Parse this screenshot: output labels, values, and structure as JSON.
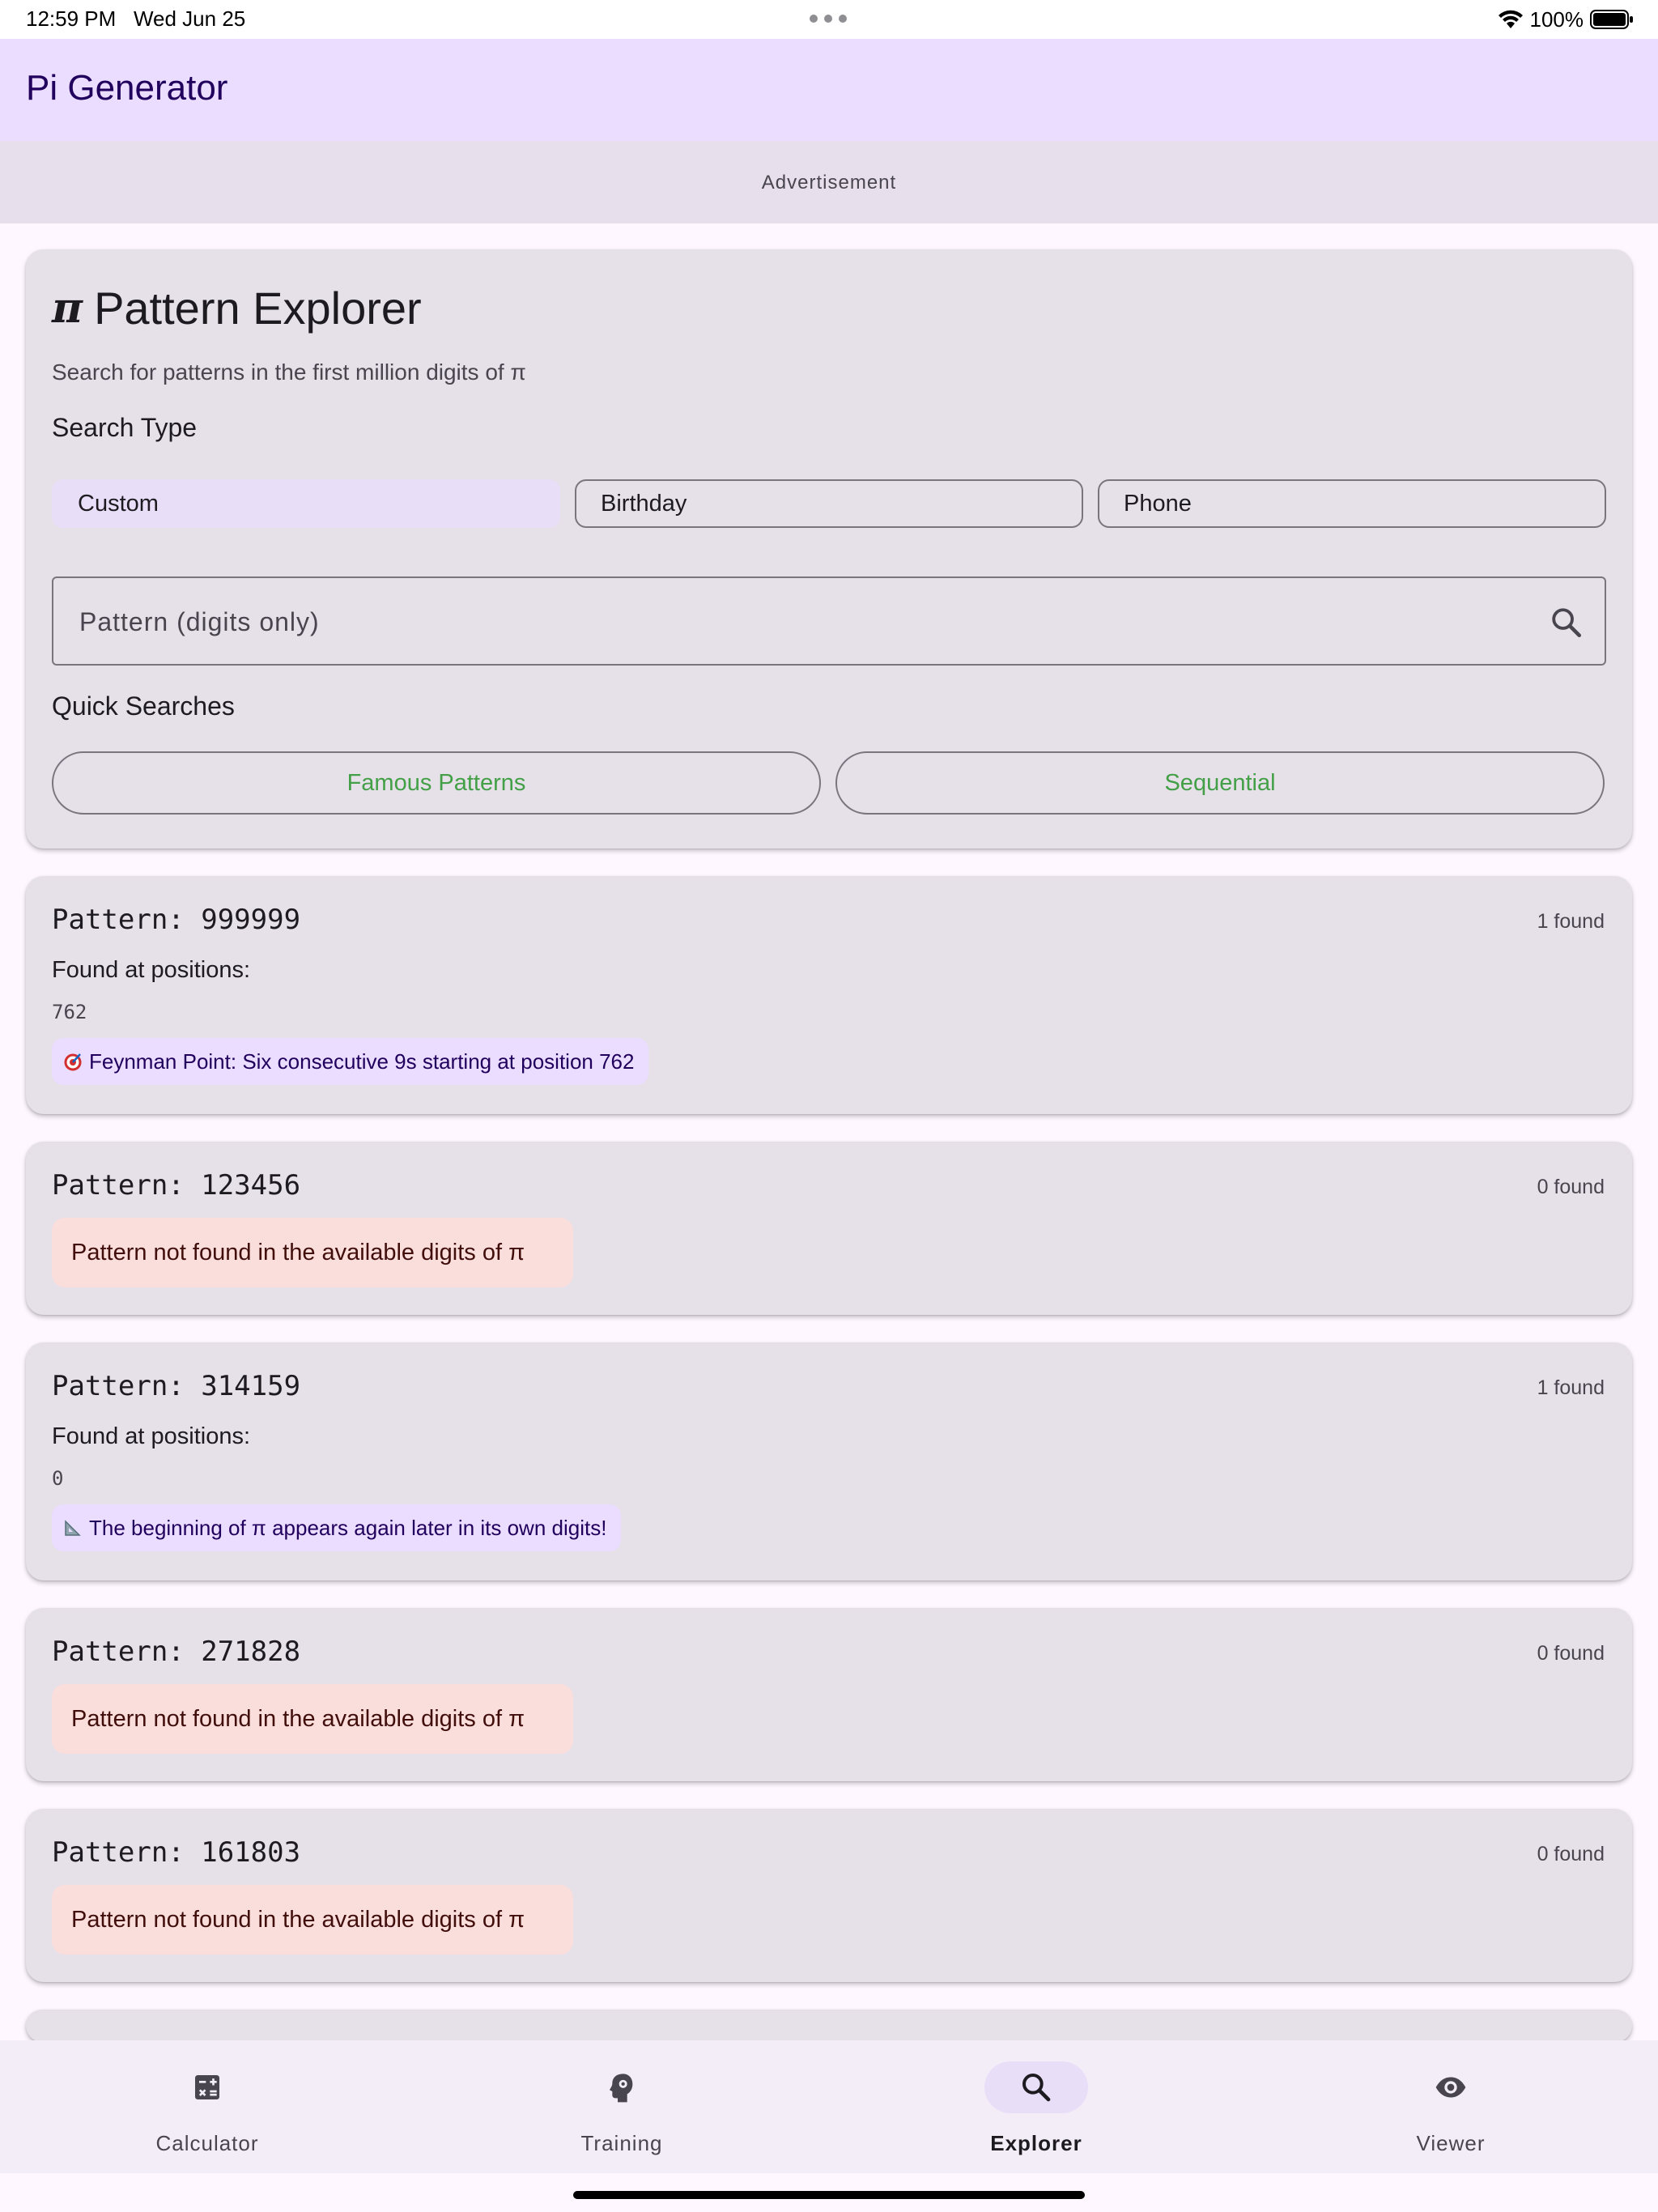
{
  "status_bar": {
    "time": "12:59 PM",
    "date": "Wed Jun 25",
    "battery": "100%"
  },
  "app_bar": {
    "title": "Pi Generator"
  },
  "ad": {
    "label": "Advertisement"
  },
  "explorer": {
    "title": "Pattern Explorer",
    "pi_symbol": "π",
    "subtitle": "Search for patterns in the first million digits of π",
    "search_type_label": "Search Type",
    "search_types": [
      "Custom",
      "Birthday",
      "Phone"
    ],
    "selected_search_type": "Custom",
    "input_placeholder": "Pattern (digits only)",
    "input_value": "",
    "quick_searches_label": "Quick Searches",
    "quick_searches": [
      "Famous Patterns",
      "Sequential"
    ],
    "quick_search_color": "#43A047"
  },
  "results": [
    {
      "pattern": "Pattern: 999999",
      "count": "1 found",
      "found_label": "Found at positions:",
      "positions": "762",
      "note_icon": "target-icon",
      "note": "Feynman Point: Six consecutive 9s starting at position 762"
    },
    {
      "pattern": "Pattern: 123456",
      "count": "0 found",
      "error": "Pattern not found in the available digits of π"
    },
    {
      "pattern": "Pattern: 314159",
      "count": "1 found",
      "found_label": "Found at positions:",
      "positions": "0",
      "note_icon": "triangle-ruler-icon",
      "note": "The beginning of π appears again later in its own digits!"
    },
    {
      "pattern": "Pattern: 271828",
      "count": "0 found",
      "error": "Pattern not found in the available digits of π"
    },
    {
      "pattern": "Pattern: 161803",
      "count": "0 found",
      "error": "Pattern not found in the available digits of π"
    }
  ],
  "nav": {
    "items": [
      {
        "label": "Calculator",
        "icon": "calculator-icon"
      },
      {
        "label": "Training",
        "icon": "brain-icon"
      },
      {
        "label": "Explorer",
        "icon": "search-icon"
      },
      {
        "label": "Viewer",
        "icon": "eye-icon"
      }
    ],
    "active": "Explorer"
  },
  "colors": {
    "app_bar": "#EADDFF",
    "card": "#E6E0E9",
    "selected_segment": "#E8DEF8",
    "error_chip": "#F9DEDC",
    "note_chip": "#EADDFF"
  }
}
